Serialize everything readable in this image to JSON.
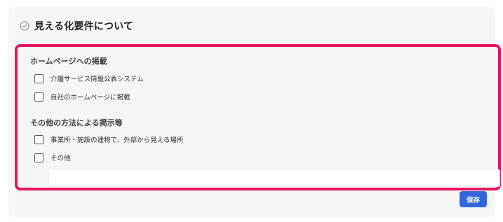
{
  "header": {
    "title": "見える化要件について",
    "icon": "check-circle-icon"
  },
  "section_homepage": {
    "title": "ホームページへの掲載",
    "options": [
      {
        "label": "介護サービス情報公表システム",
        "checked": false
      },
      {
        "label": "自社のホームページに掲載",
        "checked": false
      }
    ]
  },
  "section_other": {
    "title": "その他の方法による掲示等",
    "options": [
      {
        "label": "事業所・施設の建物で、外部から見える場所",
        "checked": false
      },
      {
        "label": "その他",
        "checked": false
      }
    ],
    "other_input": {
      "value": "",
      "placeholder": ""
    }
  },
  "footer": {
    "save_label": "保存"
  },
  "colors": {
    "highlight_border": "#e8155f",
    "save_button": "#3366dd",
    "card_bg": "#f6f6f7"
  }
}
